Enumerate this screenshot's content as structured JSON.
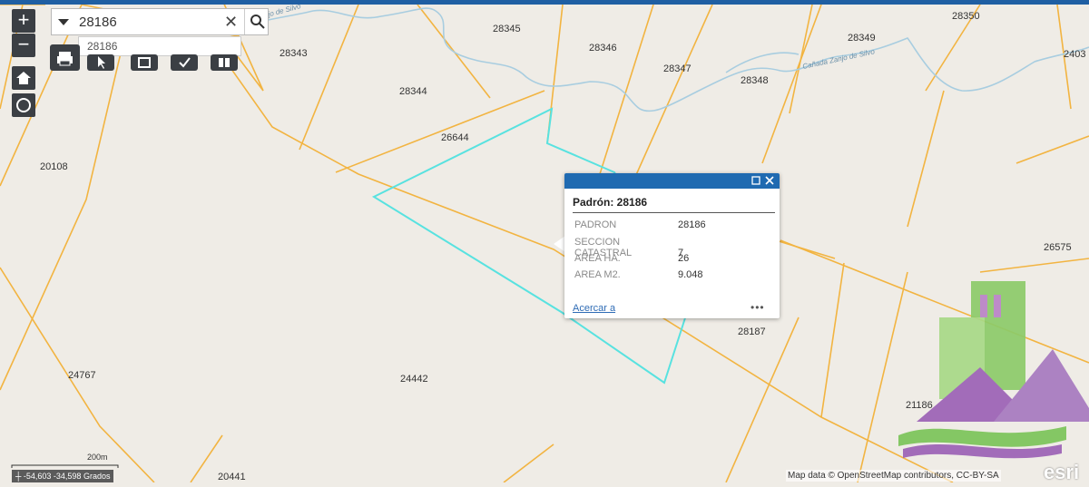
{
  "map": {
    "parcels": [
      "28350",
      "28345",
      "28346",
      "28349",
      "2403",
      "28343",
      "28347",
      "28348",
      "28344",
      "26644",
      "20108",
      "26575",
      "28187",
      "24767",
      "24442",
      "21186",
      "20441"
    ],
    "streams": [
      "Zanjo de Silvo",
      "Cañada Zanjo de Silvo"
    ]
  },
  "search": {
    "value": "28186",
    "clear_icon": "close-icon",
    "search_icon": "search-icon",
    "suggestion": "28186"
  },
  "toolbar": [
    "print-icon",
    "select-icon",
    "layers-icon",
    "edit-icon",
    "table-icon"
  ],
  "popup": {
    "title": "Padrón: 28186",
    "fields": [
      {
        "key": "PADRON",
        "value": "28186"
      },
      {
        "key": "SECCION CATASTRAL",
        "value": "7"
      },
      {
        "key": "AREA HA.",
        "value": "26"
      },
      {
        "key": "AREA M2.",
        "value": "9.048"
      }
    ],
    "zoom_link": "Acercar a",
    "more": "•••"
  },
  "footer": {
    "coordinates": "-54,603 -34,598 Grados",
    "scale": "200m",
    "attribution": "Map data © OpenStreetMap contributors, CC-BY-SA",
    "esri": "esri"
  },
  "colors": {
    "parcel_line": "#f2b441",
    "selected_parcel": "#58e2e0",
    "stream": "#a8cde0",
    "header": "#1f6ab1"
  }
}
